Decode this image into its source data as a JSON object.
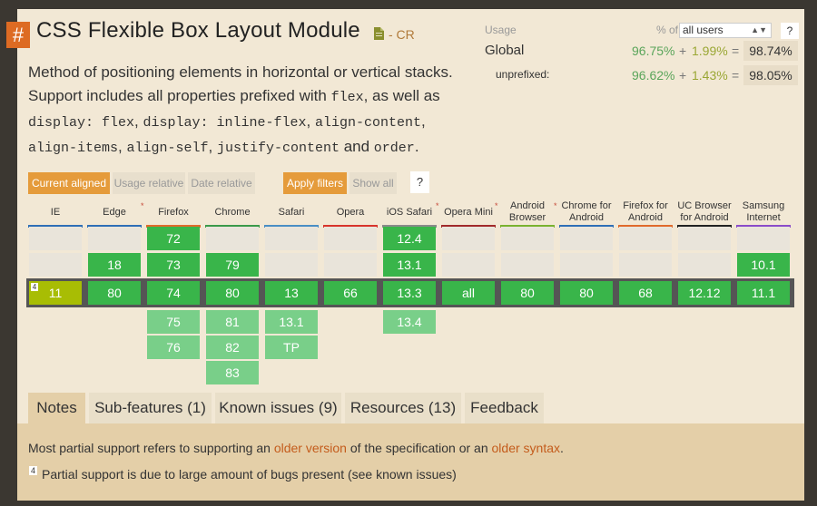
{
  "feature": {
    "hash": "#",
    "title": "CSS Flexible Box Layout Module",
    "status": "- CR",
    "desc_parts": [
      "Method of positioning elements in horizontal or vertical stacks. Support includes all properties prefixed with ",
      "flex",
      ", as well as ",
      "display: flex",
      ", ",
      "display: inline-flex",
      ", ",
      "align-content",
      ", ",
      "align-items",
      ", ",
      "align-self",
      ", ",
      "justify-content",
      " and ",
      "order",
      "."
    ]
  },
  "usage": {
    "label": "Usage",
    "pct_of": "% of",
    "select_value": "all users",
    "help": "?",
    "global": {
      "label": "Global",
      "full": "96.75%",
      "plus": "+",
      "partial": "1.99%",
      "eq": "=",
      "total": "98.74%"
    },
    "unprefixed": {
      "label": "unprefixed:",
      "full": "96.62%",
      "plus": "+",
      "partial": "1.43%",
      "eq": "=",
      "total": "98.05%"
    }
  },
  "filters": {
    "current_aligned": "Current aligned",
    "usage_relative": "Usage relative",
    "date_relative": "Date relative",
    "apply_filters": "Apply filters",
    "show_all": "Show all",
    "help": "?"
  },
  "colors": {
    "supported": "#39b54a",
    "partial": "#a8bd04",
    "future": "#79cf89"
  },
  "browsers": [
    {
      "name": "IE",
      "bar": "#2f6fb6",
      "star": false,
      "above": [
        "",
        ""
      ],
      "current": "11",
      "current_state": "partial",
      "current_note": "4",
      "below": []
    },
    {
      "name": "Edge",
      "bar": "#2f6fb6",
      "star": true,
      "above": [
        "",
        "18"
      ],
      "current": "80",
      "current_state": "supported",
      "below": []
    },
    {
      "name": "Firefox",
      "bar": "#e06a2b",
      "star": false,
      "above": [
        "72",
        "73"
      ],
      "current": "74",
      "current_state": "supported",
      "below": [
        "75",
        "76"
      ]
    },
    {
      "name": "Chrome",
      "bar": "#3b9a4a",
      "star": false,
      "above": [
        "",
        "79"
      ],
      "current": "80",
      "current_state": "supported",
      "below": [
        "81",
        "82",
        "83"
      ]
    },
    {
      "name": "Safari",
      "bar": "#4a8ec4",
      "star": false,
      "above": [
        "",
        ""
      ],
      "current": "13",
      "current_state": "supported",
      "below": [
        "13.1",
        "TP"
      ]
    },
    {
      "name": "Opera",
      "bar": "#d8342b",
      "star": false,
      "above": [
        "",
        ""
      ],
      "current": "66",
      "current_state": "supported",
      "below": []
    },
    {
      "name": "iOS Safari",
      "bar": "#8a8a8a",
      "star": true,
      "above": [
        "12.4",
        "13.1"
      ],
      "current": "13.3",
      "current_state": "supported",
      "below": [
        "13.4"
      ]
    },
    {
      "name": "Opera Mini",
      "bar": "#a12a2a",
      "star": true,
      "above": [
        "",
        ""
      ],
      "current": "all",
      "current_state": "supported",
      "below": []
    },
    {
      "name": "Android Browser",
      "bar": "#7ab230",
      "star": true,
      "above": [
        "",
        ""
      ],
      "current": "80",
      "current_state": "supported",
      "below": []
    },
    {
      "name": "Chrome for Android",
      "bar": "#2f6fb6",
      "star": false,
      "above": [
        "",
        ""
      ],
      "current": "80",
      "current_state": "supported",
      "below": []
    },
    {
      "name": "Firefox for Android",
      "bar": "#e06a2b",
      "star": false,
      "above": [
        "",
        ""
      ],
      "current": "68",
      "current_state": "supported",
      "below": []
    },
    {
      "name": "UC Browser for Android",
      "bar": "#222222",
      "star": false,
      "above": [
        "",
        ""
      ],
      "current": "12.12",
      "current_state": "supported",
      "below": []
    },
    {
      "name": "Samsung Internet",
      "bar": "#8a4cc9",
      "star": false,
      "above": [
        "",
        "10.1"
      ],
      "current": "11.1",
      "current_state": "supported",
      "below": []
    }
  ],
  "tabs": [
    "Notes",
    "Sub-features (1)",
    "Known issues (9)",
    "Resources (13)",
    "Feedback"
  ],
  "notes": {
    "line1_a": "Most partial support refers to supporting an ",
    "line1_link1": "older version",
    "line1_b": " of the specification or an ",
    "line1_link2": "older syntax",
    "line1_c": ".",
    "footnote_num": "4",
    "footnote_text": "Partial support is due to large amount of bugs present (see known issues)"
  }
}
